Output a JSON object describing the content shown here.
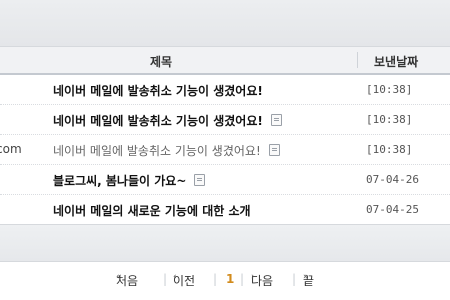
{
  "table": {
    "header": {
      "subject": "제목",
      "date": "보낸날짜"
    },
    "rows": [
      {
        "sender": "",
        "subject": "네이버 메일에 발송취소 기능이 생겼어요!",
        "date": "[10:38]",
        "memo": false,
        "read": false
      },
      {
        "sender": "",
        "subject": "네이버 메일에 발송취소 기능이 생겼어요!",
        "date": "[10:38]",
        "memo": true,
        "read": false
      },
      {
        "sender": "com",
        "subject": "네이버 메일에 발송취소 기능이 생겼어요!",
        "date": "[10:38]",
        "memo": true,
        "read": true
      },
      {
        "sender": "",
        "subject": "블로그씨, 봄나들이 가요~",
        "date": "07-04-26",
        "memo": true,
        "read": false
      },
      {
        "sender": "",
        "subject": "네이버 메일의 새로운 기능에 대한 소개",
        "date": "07-04-25",
        "memo": false,
        "read": false
      }
    ]
  },
  "pager": {
    "first": "처음",
    "prev": "이전",
    "current_page": "1",
    "next": "다음",
    "last": "끝",
    "arrows": {
      "first": "«",
      "prev": "‹",
      "next": "›",
      "last": "»"
    },
    "current_color": "#d28b1c"
  }
}
